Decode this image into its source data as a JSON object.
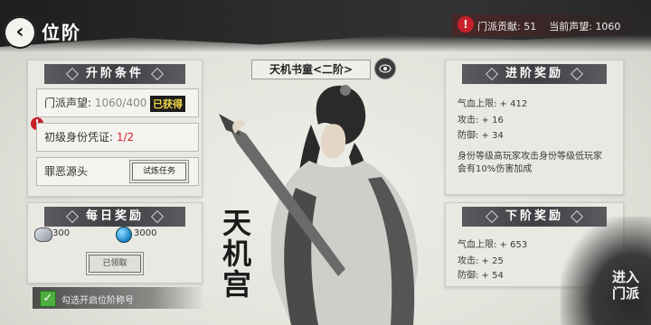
{
  "header": {
    "back_icon": "‹",
    "title": "位阶",
    "contribution_label": "门派贡献:",
    "contribution_value": "51",
    "prestige_label": "当前声望:",
    "prestige_value": "1060"
  },
  "promote_conditions": {
    "heading": "升阶条件",
    "row1_label": "门派声望:",
    "row1_value": "1060/400",
    "row1_badge": "已获得",
    "row2_label": "初级身份凭证:",
    "row2_value": "1/2",
    "row3_label": "罪恶源头",
    "row3_button": "试炼任务"
  },
  "daily_reward": {
    "heading": "每日奖励",
    "item1_value": "300",
    "item2_value": "3000",
    "claim_button": "已领取"
  },
  "auto_title": {
    "label": "勾选开启位阶称号",
    "checked": true
  },
  "center": {
    "rank_title": "天机书童<二阶>",
    "eye_label": "预览",
    "sect_char1": "天",
    "sect_char2": "机",
    "sect_char3": "宫"
  },
  "advance_reward": {
    "heading": "进阶奖励",
    "hp": "气血上限: + 412",
    "atk": "攻击: + 16",
    "def": "防御: + 34",
    "note_line1": "身份等级高玩家攻击身份等级低玩家",
    "note_line2": "会有10%伤害加成"
  },
  "next_reward": {
    "heading": "下阶奖励",
    "hp": "气血上限: + 653",
    "atk": "攻击: + 25",
    "def": "防御: + 54"
  },
  "enter_button": {
    "line1": "进入",
    "line2": "门派"
  },
  "colors": {
    "warn": "#c7202a",
    "progress_red": "#d0202a",
    "badge_gold": "#f1d84a",
    "check_green": "#4caf3f"
  }
}
